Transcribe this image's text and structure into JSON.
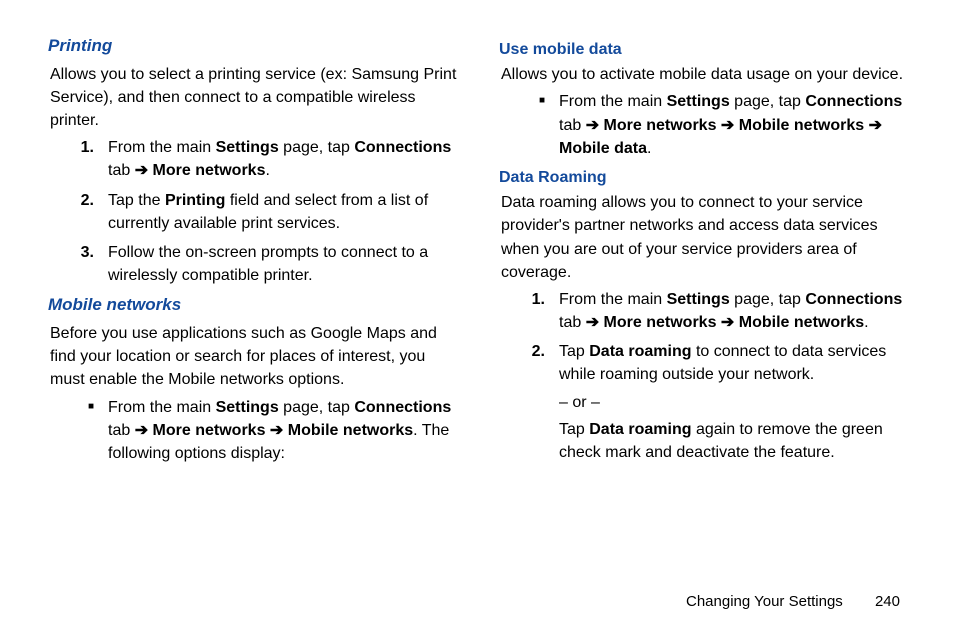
{
  "left": {
    "printing": {
      "heading": "Printing",
      "intro": "Allows you to select a printing service (ex: Samsung Print Service), and then connect to a compatible wireless printer.",
      "steps": [
        {
          "num": "1.",
          "parts": [
            "From the main ",
            "Settings",
            " page, tap ",
            "Connections",
            " tab ",
            "➔",
            " ",
            "More networks",
            "."
          ],
          "bold": [
            1,
            3,
            5,
            7
          ]
        },
        {
          "num": "2.",
          "parts": [
            "Tap the ",
            "Printing",
            " field and select from a list of currently available print services."
          ],
          "bold": [
            1
          ]
        },
        {
          "num": "3.",
          "parts": [
            "Follow the on-screen prompts to connect to a wirelessly compatible printer."
          ],
          "bold": []
        }
      ]
    },
    "mobileNetworks": {
      "heading": "Mobile networks",
      "intro": "Before you use applications such as Google Maps and find your location or search for places of interest, you must enable the Mobile networks options.",
      "bullet": {
        "parts": [
          "From the main ",
          "Settings",
          " page, tap ",
          "Connections",
          " tab ",
          "➔",
          " ",
          "More networks",
          " ",
          "➔",
          " ",
          "Mobile networks",
          ". The following options display:"
        ],
        "bold": [
          1,
          3,
          5,
          7,
          9,
          11
        ]
      }
    }
  },
  "right": {
    "useMobileData": {
      "heading": "Use mobile data",
      "intro": "Allows you to activate mobile data usage on your device.",
      "bullet": {
        "parts": [
          "From the main ",
          "Settings",
          " page, tap ",
          "Connections",
          " tab ",
          "➔",
          " ",
          "More networks",
          " ",
          "➔",
          " ",
          "Mobile networks",
          " ",
          "➔",
          " ",
          "Mobile data",
          "."
        ],
        "bold": [
          1,
          3,
          5,
          7,
          9,
          11,
          13,
          15
        ]
      }
    },
    "dataRoaming": {
      "heading": "Data Roaming",
      "intro": "Data roaming allows you to connect to your service provider's partner networks and access data services when you are out of your service providers area of coverage.",
      "steps": [
        {
          "num": "1.",
          "parts": [
            "From the main ",
            "Settings",
            " page, tap ",
            "Connections",
            " tab ",
            "➔",
            " ",
            "More networks",
            " ",
            "➔",
            " ",
            "Mobile networks",
            "."
          ],
          "bold": [
            1,
            3,
            5,
            7,
            9,
            11
          ]
        },
        {
          "num": "2.",
          "parts": [
            "Tap ",
            "Data roaming",
            " to connect to data services while roaming outside your network."
          ],
          "bold": [
            1
          ],
          "extras": [
            {
              "parts": [
                "– or –"
              ],
              "bold": []
            },
            {
              "parts": [
                "Tap ",
                "Data roaming",
                " again to remove the green check mark and deactivate the feature."
              ],
              "bold": [
                1
              ]
            }
          ]
        }
      ]
    }
  },
  "footer": {
    "section": "Changing Your Settings",
    "page": "240"
  },
  "bulletChar": "■"
}
